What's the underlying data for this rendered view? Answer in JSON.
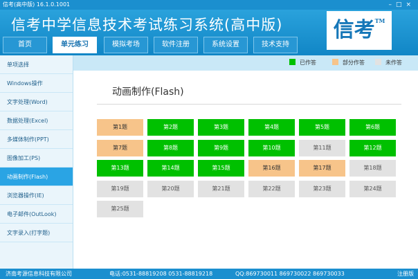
{
  "window": {
    "title": "信考(高中版)  16.1.0.1001",
    "controls": [
      "–",
      "□",
      "×"
    ]
  },
  "header": {
    "app_title": "信考中学信息技术考试练习系统(高中版)",
    "logo_text": "信考",
    "logo_mark": "TM"
  },
  "nav": {
    "tabs": [
      {
        "label": "首页",
        "active": false
      },
      {
        "label": "单元练习",
        "active": true
      },
      {
        "label": "模拟考场",
        "active": false
      },
      {
        "label": "软件注册",
        "active": false
      },
      {
        "label": "系统设置",
        "active": false
      },
      {
        "label": "技术支持",
        "active": false
      }
    ]
  },
  "sidebar": {
    "items": [
      {
        "label": "单项选择",
        "active": false
      },
      {
        "label": "Windows操作",
        "active": false
      },
      {
        "label": "文字处理(Word)",
        "active": false
      },
      {
        "label": "数据处理(Excel)",
        "active": false
      },
      {
        "label": "多媒体制作(PPT)",
        "active": false
      },
      {
        "label": "图像加工(PS)",
        "active": false
      },
      {
        "label": "动画制作(Flash)",
        "active": true
      },
      {
        "label": "浏览器操作(IE)",
        "active": false
      },
      {
        "label": "电子邮件(OutLook)",
        "active": false
      },
      {
        "label": "文字录入(打字题)",
        "active": false
      }
    ]
  },
  "legend": {
    "items": [
      {
        "label": "已作答",
        "color": "#00c000"
      },
      {
        "label": "部分作答",
        "color": "#f7c48a"
      },
      {
        "label": "未作答",
        "color": "#e2e2e2"
      }
    ]
  },
  "main": {
    "title": "动画制作(Flash)",
    "questions": [
      {
        "label": "第1题",
        "status": "partial"
      },
      {
        "label": "第2题",
        "status": "done"
      },
      {
        "label": "第3题",
        "status": "done"
      },
      {
        "label": "第4题",
        "status": "done"
      },
      {
        "label": "第5题",
        "status": "done"
      },
      {
        "label": "第6题",
        "status": "done"
      },
      {
        "label": "第7题",
        "status": "partial"
      },
      {
        "label": "第8题",
        "status": "done"
      },
      {
        "label": "第9题",
        "status": "done"
      },
      {
        "label": "第10题",
        "status": "done"
      },
      {
        "label": "第11题",
        "status": "none"
      },
      {
        "label": "第12题",
        "status": "done"
      },
      {
        "label": "第13题",
        "status": "done"
      },
      {
        "label": "第14题",
        "status": "done"
      },
      {
        "label": "第15题",
        "status": "done"
      },
      {
        "label": "第16题",
        "status": "partial"
      },
      {
        "label": "第17题",
        "status": "partial"
      },
      {
        "label": "第18题",
        "status": "none"
      },
      {
        "label": "第19题",
        "status": "none"
      },
      {
        "label": "第20题",
        "status": "none"
      },
      {
        "label": "第21题",
        "status": "none"
      },
      {
        "label": "第22题",
        "status": "none"
      },
      {
        "label": "第23题",
        "status": "none"
      },
      {
        "label": "第24题",
        "status": "none"
      },
      {
        "label": "第25题",
        "status": "none"
      }
    ]
  },
  "footer": {
    "company": "济南考源信息科技有限公司",
    "phone": "电话:0531-88819208  0531-88819218",
    "qq": "QQ:869730011  869730022  869730033",
    "status": "注册版"
  }
}
